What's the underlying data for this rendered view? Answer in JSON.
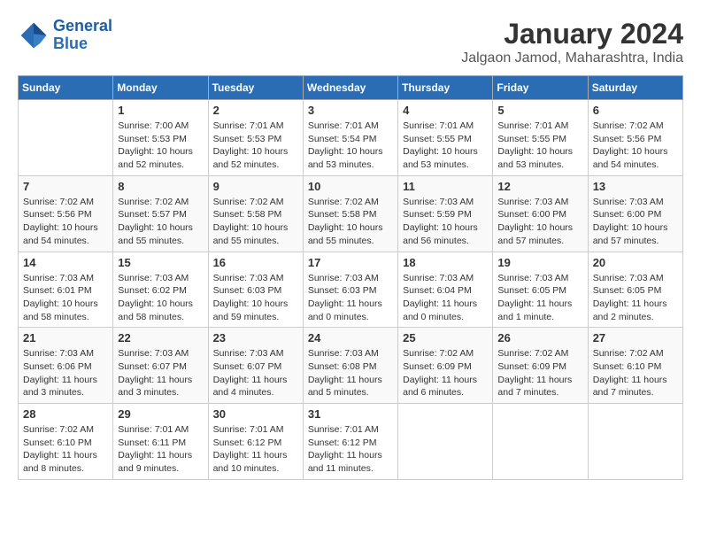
{
  "logo": {
    "line1": "General",
    "line2": "Blue"
  },
  "title": "January 2024",
  "subtitle": "Jalgaon Jamod, Maharashtra, India",
  "days_of_week": [
    "Sunday",
    "Monday",
    "Tuesday",
    "Wednesday",
    "Thursday",
    "Friday",
    "Saturday"
  ],
  "weeks": [
    [
      {
        "num": "",
        "info": ""
      },
      {
        "num": "1",
        "info": "Sunrise: 7:00 AM\nSunset: 5:53 PM\nDaylight: 10 hours\nand 52 minutes."
      },
      {
        "num": "2",
        "info": "Sunrise: 7:01 AM\nSunset: 5:53 PM\nDaylight: 10 hours\nand 52 minutes."
      },
      {
        "num": "3",
        "info": "Sunrise: 7:01 AM\nSunset: 5:54 PM\nDaylight: 10 hours\nand 53 minutes."
      },
      {
        "num": "4",
        "info": "Sunrise: 7:01 AM\nSunset: 5:55 PM\nDaylight: 10 hours\nand 53 minutes."
      },
      {
        "num": "5",
        "info": "Sunrise: 7:01 AM\nSunset: 5:55 PM\nDaylight: 10 hours\nand 53 minutes."
      },
      {
        "num": "6",
        "info": "Sunrise: 7:02 AM\nSunset: 5:56 PM\nDaylight: 10 hours\nand 54 minutes."
      }
    ],
    [
      {
        "num": "7",
        "info": "Sunrise: 7:02 AM\nSunset: 5:56 PM\nDaylight: 10 hours\nand 54 minutes."
      },
      {
        "num": "8",
        "info": "Sunrise: 7:02 AM\nSunset: 5:57 PM\nDaylight: 10 hours\nand 55 minutes."
      },
      {
        "num": "9",
        "info": "Sunrise: 7:02 AM\nSunset: 5:58 PM\nDaylight: 10 hours\nand 55 minutes."
      },
      {
        "num": "10",
        "info": "Sunrise: 7:02 AM\nSunset: 5:58 PM\nDaylight: 10 hours\nand 55 minutes."
      },
      {
        "num": "11",
        "info": "Sunrise: 7:03 AM\nSunset: 5:59 PM\nDaylight: 10 hours\nand 56 minutes."
      },
      {
        "num": "12",
        "info": "Sunrise: 7:03 AM\nSunset: 6:00 PM\nDaylight: 10 hours\nand 57 minutes."
      },
      {
        "num": "13",
        "info": "Sunrise: 7:03 AM\nSunset: 6:00 PM\nDaylight: 10 hours\nand 57 minutes."
      }
    ],
    [
      {
        "num": "14",
        "info": "Sunrise: 7:03 AM\nSunset: 6:01 PM\nDaylight: 10 hours\nand 58 minutes."
      },
      {
        "num": "15",
        "info": "Sunrise: 7:03 AM\nSunset: 6:02 PM\nDaylight: 10 hours\nand 58 minutes."
      },
      {
        "num": "16",
        "info": "Sunrise: 7:03 AM\nSunset: 6:03 PM\nDaylight: 10 hours\nand 59 minutes."
      },
      {
        "num": "17",
        "info": "Sunrise: 7:03 AM\nSunset: 6:03 PM\nDaylight: 11 hours\nand 0 minutes."
      },
      {
        "num": "18",
        "info": "Sunrise: 7:03 AM\nSunset: 6:04 PM\nDaylight: 11 hours\nand 0 minutes."
      },
      {
        "num": "19",
        "info": "Sunrise: 7:03 AM\nSunset: 6:05 PM\nDaylight: 11 hours\nand 1 minute."
      },
      {
        "num": "20",
        "info": "Sunrise: 7:03 AM\nSunset: 6:05 PM\nDaylight: 11 hours\nand 2 minutes."
      }
    ],
    [
      {
        "num": "21",
        "info": "Sunrise: 7:03 AM\nSunset: 6:06 PM\nDaylight: 11 hours\nand 3 minutes."
      },
      {
        "num": "22",
        "info": "Sunrise: 7:03 AM\nSunset: 6:07 PM\nDaylight: 11 hours\nand 3 minutes."
      },
      {
        "num": "23",
        "info": "Sunrise: 7:03 AM\nSunset: 6:07 PM\nDaylight: 11 hours\nand 4 minutes."
      },
      {
        "num": "24",
        "info": "Sunrise: 7:03 AM\nSunset: 6:08 PM\nDaylight: 11 hours\nand 5 minutes."
      },
      {
        "num": "25",
        "info": "Sunrise: 7:02 AM\nSunset: 6:09 PM\nDaylight: 11 hours\nand 6 minutes."
      },
      {
        "num": "26",
        "info": "Sunrise: 7:02 AM\nSunset: 6:09 PM\nDaylight: 11 hours\nand 7 minutes."
      },
      {
        "num": "27",
        "info": "Sunrise: 7:02 AM\nSunset: 6:10 PM\nDaylight: 11 hours\nand 7 minutes."
      }
    ],
    [
      {
        "num": "28",
        "info": "Sunrise: 7:02 AM\nSunset: 6:10 PM\nDaylight: 11 hours\nand 8 minutes."
      },
      {
        "num": "29",
        "info": "Sunrise: 7:01 AM\nSunset: 6:11 PM\nDaylight: 11 hours\nand 9 minutes."
      },
      {
        "num": "30",
        "info": "Sunrise: 7:01 AM\nSunset: 6:12 PM\nDaylight: 11 hours\nand 10 minutes."
      },
      {
        "num": "31",
        "info": "Sunrise: 7:01 AM\nSunset: 6:12 PM\nDaylight: 11 hours\nand 11 minutes."
      },
      {
        "num": "",
        "info": ""
      },
      {
        "num": "",
        "info": ""
      },
      {
        "num": "",
        "info": ""
      }
    ]
  ]
}
